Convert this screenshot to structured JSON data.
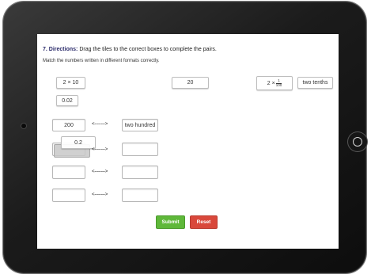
{
  "question": {
    "number": "7.",
    "directions_label": "Directions:",
    "directions_text": "Drag the tiles to the correct boxes to complete the pairs.",
    "subtext": "Match the numbers written in different formats correctly."
  },
  "tiles": {
    "t1": "2 × 10",
    "t2": "0.02",
    "t3": "20",
    "t4_prefix": "2 ×",
    "t4_num": "1",
    "t4_den": "100",
    "t5": "two tenths",
    "dragging": "0.2"
  },
  "pairs": {
    "row1_left": "200",
    "row1_right": "two hundred",
    "arrow": "<-------->"
  },
  "buttons": {
    "submit": "Submit",
    "reset": "Reset"
  },
  "colors": {
    "submit": "#5fb83a",
    "reset": "#d9483b",
    "directions": "#2b2b6b"
  }
}
